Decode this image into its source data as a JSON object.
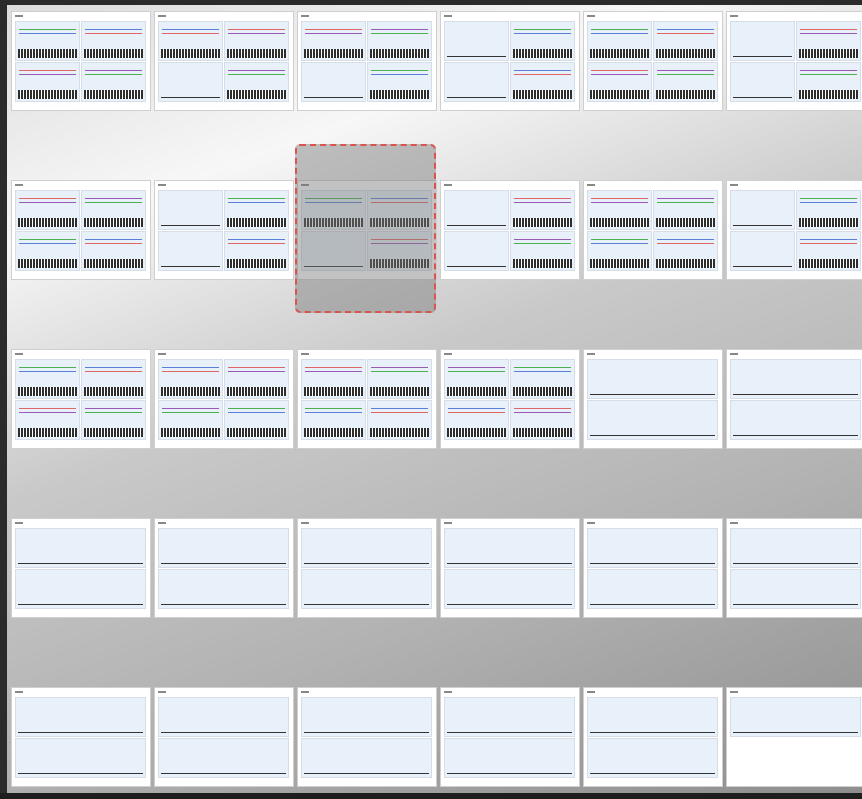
{
  "viewer": {
    "view_mode": "page-grid",
    "columns": 6,
    "selected_page": 9
  },
  "pages": [
    {
      "index": 1,
      "layout": "four-charts"
    },
    {
      "index": 2,
      "layout": "four-charts-half"
    },
    {
      "index": 3,
      "layout": "four-charts-half"
    },
    {
      "index": 4,
      "layout": "two-charts"
    },
    {
      "index": 5,
      "layout": "four-charts"
    },
    {
      "index": 6,
      "layout": "two-charts"
    },
    {
      "index": 7,
      "layout": "four-charts"
    },
    {
      "index": 8,
      "layout": "two-charts"
    },
    {
      "index": 9,
      "layout": "four-charts-half"
    },
    {
      "index": 10,
      "layout": "two-charts"
    },
    {
      "index": 11,
      "layout": "four-charts"
    },
    {
      "index": 12,
      "layout": "two-charts"
    },
    {
      "index": 13,
      "layout": "four-charts"
    },
    {
      "index": 14,
      "layout": "four-charts"
    },
    {
      "index": 15,
      "layout": "four-charts"
    },
    {
      "index": 16,
      "layout": "four-charts"
    },
    {
      "index": 17,
      "layout": "empty-panels"
    },
    {
      "index": 18,
      "layout": "empty-panels"
    },
    {
      "index": 19,
      "layout": "empty-panels"
    },
    {
      "index": 20,
      "layout": "empty-panels"
    },
    {
      "index": 21,
      "layout": "empty-panels"
    },
    {
      "index": 22,
      "layout": "empty-panels"
    },
    {
      "index": 23,
      "layout": "empty-panels"
    },
    {
      "index": 24,
      "layout": "empty-panels"
    },
    {
      "index": 25,
      "layout": "empty-panels"
    },
    {
      "index": 26,
      "layout": "empty-panels"
    },
    {
      "index": 27,
      "layout": "empty-panels"
    },
    {
      "index": 28,
      "layout": "empty-panels"
    },
    {
      "index": 29,
      "layout": "empty-panels"
    },
    {
      "index": 30,
      "layout": "single-panel"
    }
  ],
  "colors": {
    "selection_border": "#d9534f",
    "panel_bg": "#e8f0fa",
    "series_green": "#4caf50",
    "series_blue": "#5b7fd6",
    "series_red": "#e06666",
    "series_purple": "#9b59b6"
  }
}
